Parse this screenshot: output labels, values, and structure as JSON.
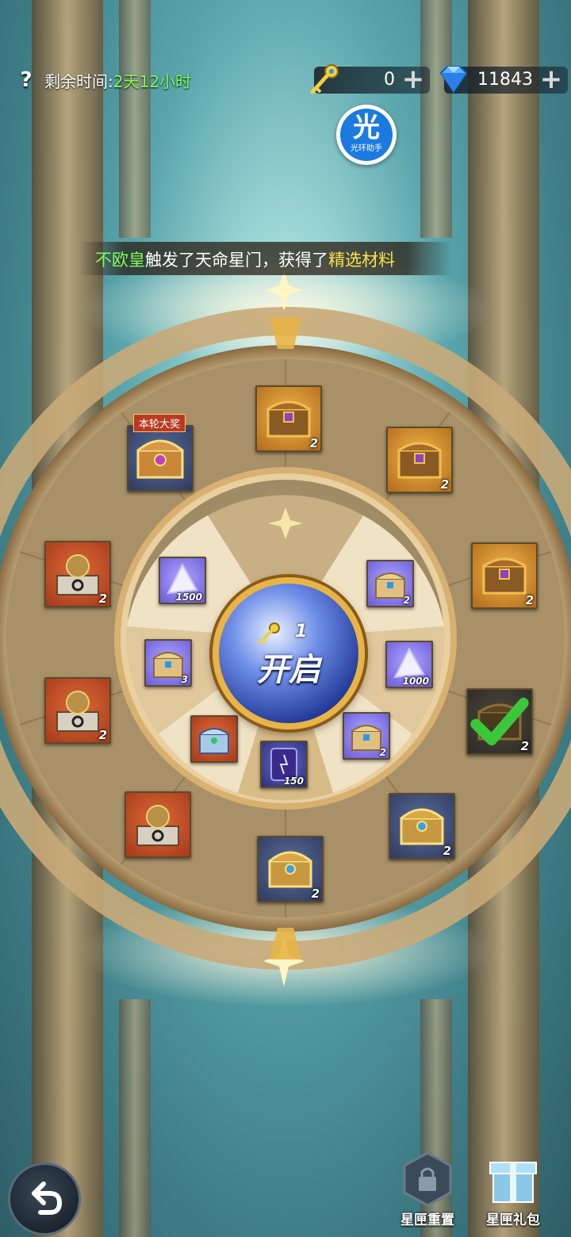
{
  "header": {
    "help_icon": "question-mark-icon",
    "timer_label": "剩余时间:",
    "timer_value": "2天12小时",
    "keys_count": "0",
    "gems_count": "11843",
    "plus_symbol": "+"
  },
  "assistant": {
    "char": "光",
    "label": "光环助手"
  },
  "marquee": {
    "part1": "不欧皇",
    "part2": "触发了天命星门，获得了",
    "part3": "精选材料"
  },
  "outer_ring": [
    {
      "kind": "chest-gold",
      "count": "2"
    },
    {
      "kind": "chest-gold",
      "count": "2"
    },
    {
      "kind": "chest-gold",
      "count": "2"
    },
    {
      "kind": "chest-claimed",
      "count": "2"
    },
    {
      "kind": "chest-ornate",
      "count": "2"
    },
    {
      "kind": "chest-ornate",
      "count": "2"
    },
    {
      "kind": "crystal-ball-stand",
      "count": ""
    },
    {
      "kind": "crystal-ball-stand",
      "count": "2"
    },
    {
      "kind": "crystal-ball-stand",
      "count": "2"
    },
    {
      "kind": "chest-grand",
      "count": "",
      "badge": "本轮大奖"
    }
  ],
  "inner_ring": [
    {
      "kind": "crystal-shard",
      "count": "1500"
    },
    {
      "kind": "blue-chest",
      "count": "2"
    },
    {
      "kind": "crystal-shard",
      "count": "1000"
    },
    {
      "kind": "blue-chest",
      "count": "2"
    },
    {
      "kind": "scroll",
      "count": "150"
    },
    {
      "kind": "blue-chest-orange",
      "count": ""
    },
    {
      "kind": "blue-chest",
      "count": "3"
    }
  ],
  "center_button": {
    "cost": "1",
    "label": "开启"
  },
  "bottom": {
    "reset_label": "星匣重置",
    "gift_label": "星匣礼包"
  },
  "colors": {
    "accent_green": "#7CFF5A",
    "accent_yellow": "#FFE14A",
    "frame_gold": "#e8b446"
  }
}
